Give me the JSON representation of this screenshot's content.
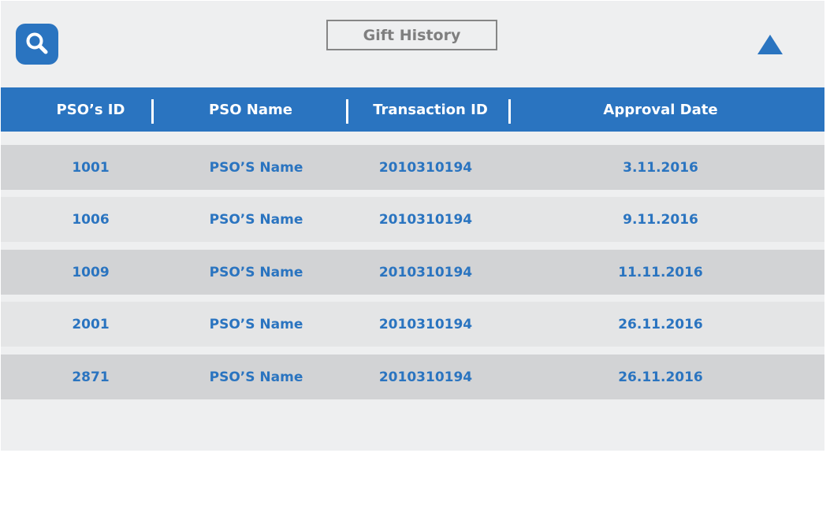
{
  "header": {
    "title": "Gift History",
    "search_icon": "search-icon",
    "collapse_icon": "triangle-up-icon"
  },
  "colors": {
    "accent": "#2a74c0",
    "row_dark": "#d2d3d5",
    "row_light": "#e4e5e6",
    "background": "#eeeff0"
  },
  "table": {
    "columns": [
      "PSO’s ID",
      "PSO Name",
      "Transaction ID",
      "Approval Date"
    ],
    "rows": [
      {
        "id": "1001",
        "name": "PSO’S Name",
        "transaction": "2010310194",
        "date": "3.11.2016"
      },
      {
        "id": "1006",
        "name": "PSO’S Name",
        "transaction": "2010310194",
        "date": "9.11.2016"
      },
      {
        "id": "1009",
        "name": "PSO’S Name",
        "transaction": "2010310194",
        "date": "11.11.2016"
      },
      {
        "id": "2001",
        "name": "PSO’S Name",
        "transaction": "2010310194",
        "date": "26.11.2016"
      },
      {
        "id": "2871",
        "name": "PSO’S Name",
        "transaction": "2010310194",
        "date": "26.11.2016"
      }
    ]
  }
}
